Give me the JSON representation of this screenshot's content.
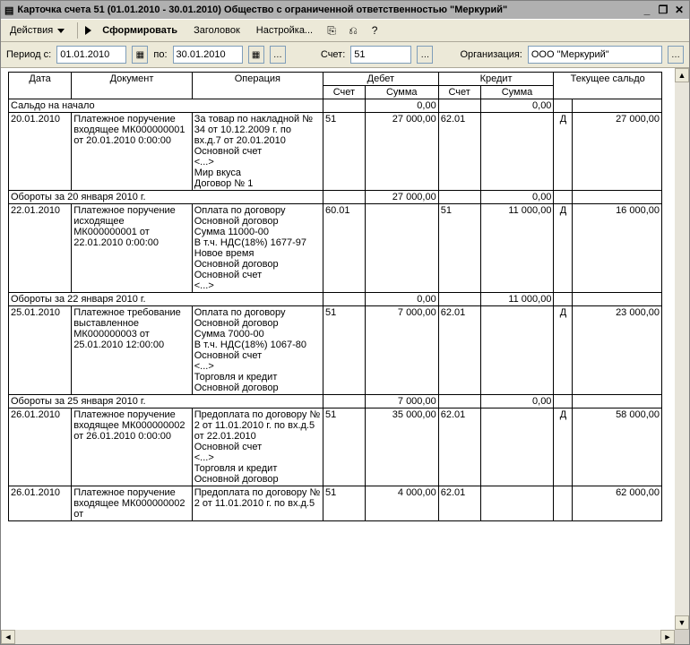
{
  "window": {
    "title": "Карточка счета 51 (01.01.2010 - 30.01.2010) Общество с ограниченной ответственностью \"Меркурий\""
  },
  "toolbar": {
    "actions": "Действия",
    "form": "Сформировать",
    "header": "Заголовок",
    "settings": "Настройка...",
    "help": "?"
  },
  "filter": {
    "period_label": "Период с:",
    "date_from": "01.01.2010",
    "to_label": "по:",
    "date_to": "30.01.2010",
    "account_label": "Счет:",
    "account": "51",
    "org_label": "Организация:",
    "org": "ООО \"Меркурий\""
  },
  "headers": {
    "date": "Дата",
    "document": "Документ",
    "operation": "Операция",
    "debit": "Дебет",
    "credit": "Кредит",
    "balance": "Текущее сальдо",
    "account": "Счет",
    "sum": "Сумма"
  },
  "rows": [
    {
      "type": "summary",
      "label": "Сальдо на начало",
      "debit_sum": "0,00",
      "credit_sum": "0,00"
    },
    {
      "type": "entry",
      "date": "20.01.2010",
      "document": "Платежное поручение входящее МК000000001 от 20.01.2010 0:00:00",
      "operation": "За товар по накладной № 34 от 10.12.2009 г. по вх.д.7 от 20.01.2010\nОсновной счет\n<...>\nМир вкуса\nДоговор № 1",
      "debit_acc": "51",
      "debit_sum": "27 000,00",
      "credit_acc": "62.01",
      "credit_sum": "",
      "bal_flag": "Д",
      "balance": "27 000,00"
    },
    {
      "type": "summary",
      "label": "Обороты за 20 января 2010 г.",
      "debit_sum": "27 000,00",
      "credit_sum": "0,00"
    },
    {
      "type": "entry",
      "date": "22.01.2010",
      "document": "Платежное поручение исходящее МК000000001 от 22.01.2010 0:00:00",
      "operation": "Оплата по договору Основной договор\nСумма 11000-00\nВ т.ч. НДС(18%) 1677-97\nНовое время\nОсновной договор\nОсновной счет\n<...>",
      "debit_acc": "60.01",
      "debit_sum": "",
      "credit_acc": "51",
      "credit_sum": "11 000,00",
      "bal_flag": "Д",
      "balance": "16 000,00"
    },
    {
      "type": "summary",
      "label": "Обороты за 22 января 2010 г.",
      "debit_sum": "0,00",
      "credit_sum": "11 000,00"
    },
    {
      "type": "entry",
      "date": "25.01.2010",
      "document": "Платежное требование выставленное МК000000003 от 25.01.2010 12:00:00",
      "operation": "Оплата по договору Основной договор\nСумма 7000-00\nВ т.ч. НДС(18%) 1067-80\nОсновной счет\n<...>\nТорговля и кредит\nОсновной договор",
      "debit_acc": "51",
      "debit_sum": "7 000,00",
      "credit_acc": "62.01",
      "credit_sum": "",
      "bal_flag": "Д",
      "balance": "23 000,00"
    },
    {
      "type": "summary",
      "label": "Обороты за 25 января 2010 г.",
      "debit_sum": "7 000,00",
      "credit_sum": "0,00"
    },
    {
      "type": "entry",
      "date": "26.01.2010",
      "document": "Платежное поручение входящее МК000000002 от 26.01.2010 0:00:00",
      "operation": "Предоплата по договору № 2 от 11.01.2010 г. по вх.д.5 от 22.01.2010\nОсновной счет\n<...>\nТорговля и кредит\nОсновной договор",
      "debit_acc": "51",
      "debit_sum": "35 000,00",
      "credit_acc": "62.01",
      "credit_sum": "",
      "bal_flag": "Д",
      "balance": "58 000,00"
    },
    {
      "type": "entry",
      "date": "26.01.2010",
      "document": "Платежное поручение входящее МК000000002 от",
      "operation": "Предоплата по договору № 2 от 11.01.2010 г. по вх.д.5",
      "debit_acc": "51",
      "debit_sum": "4 000,00",
      "credit_acc": "62.01",
      "credit_sum": "",
      "bal_flag": "",
      "balance": "62 000,00"
    }
  ]
}
